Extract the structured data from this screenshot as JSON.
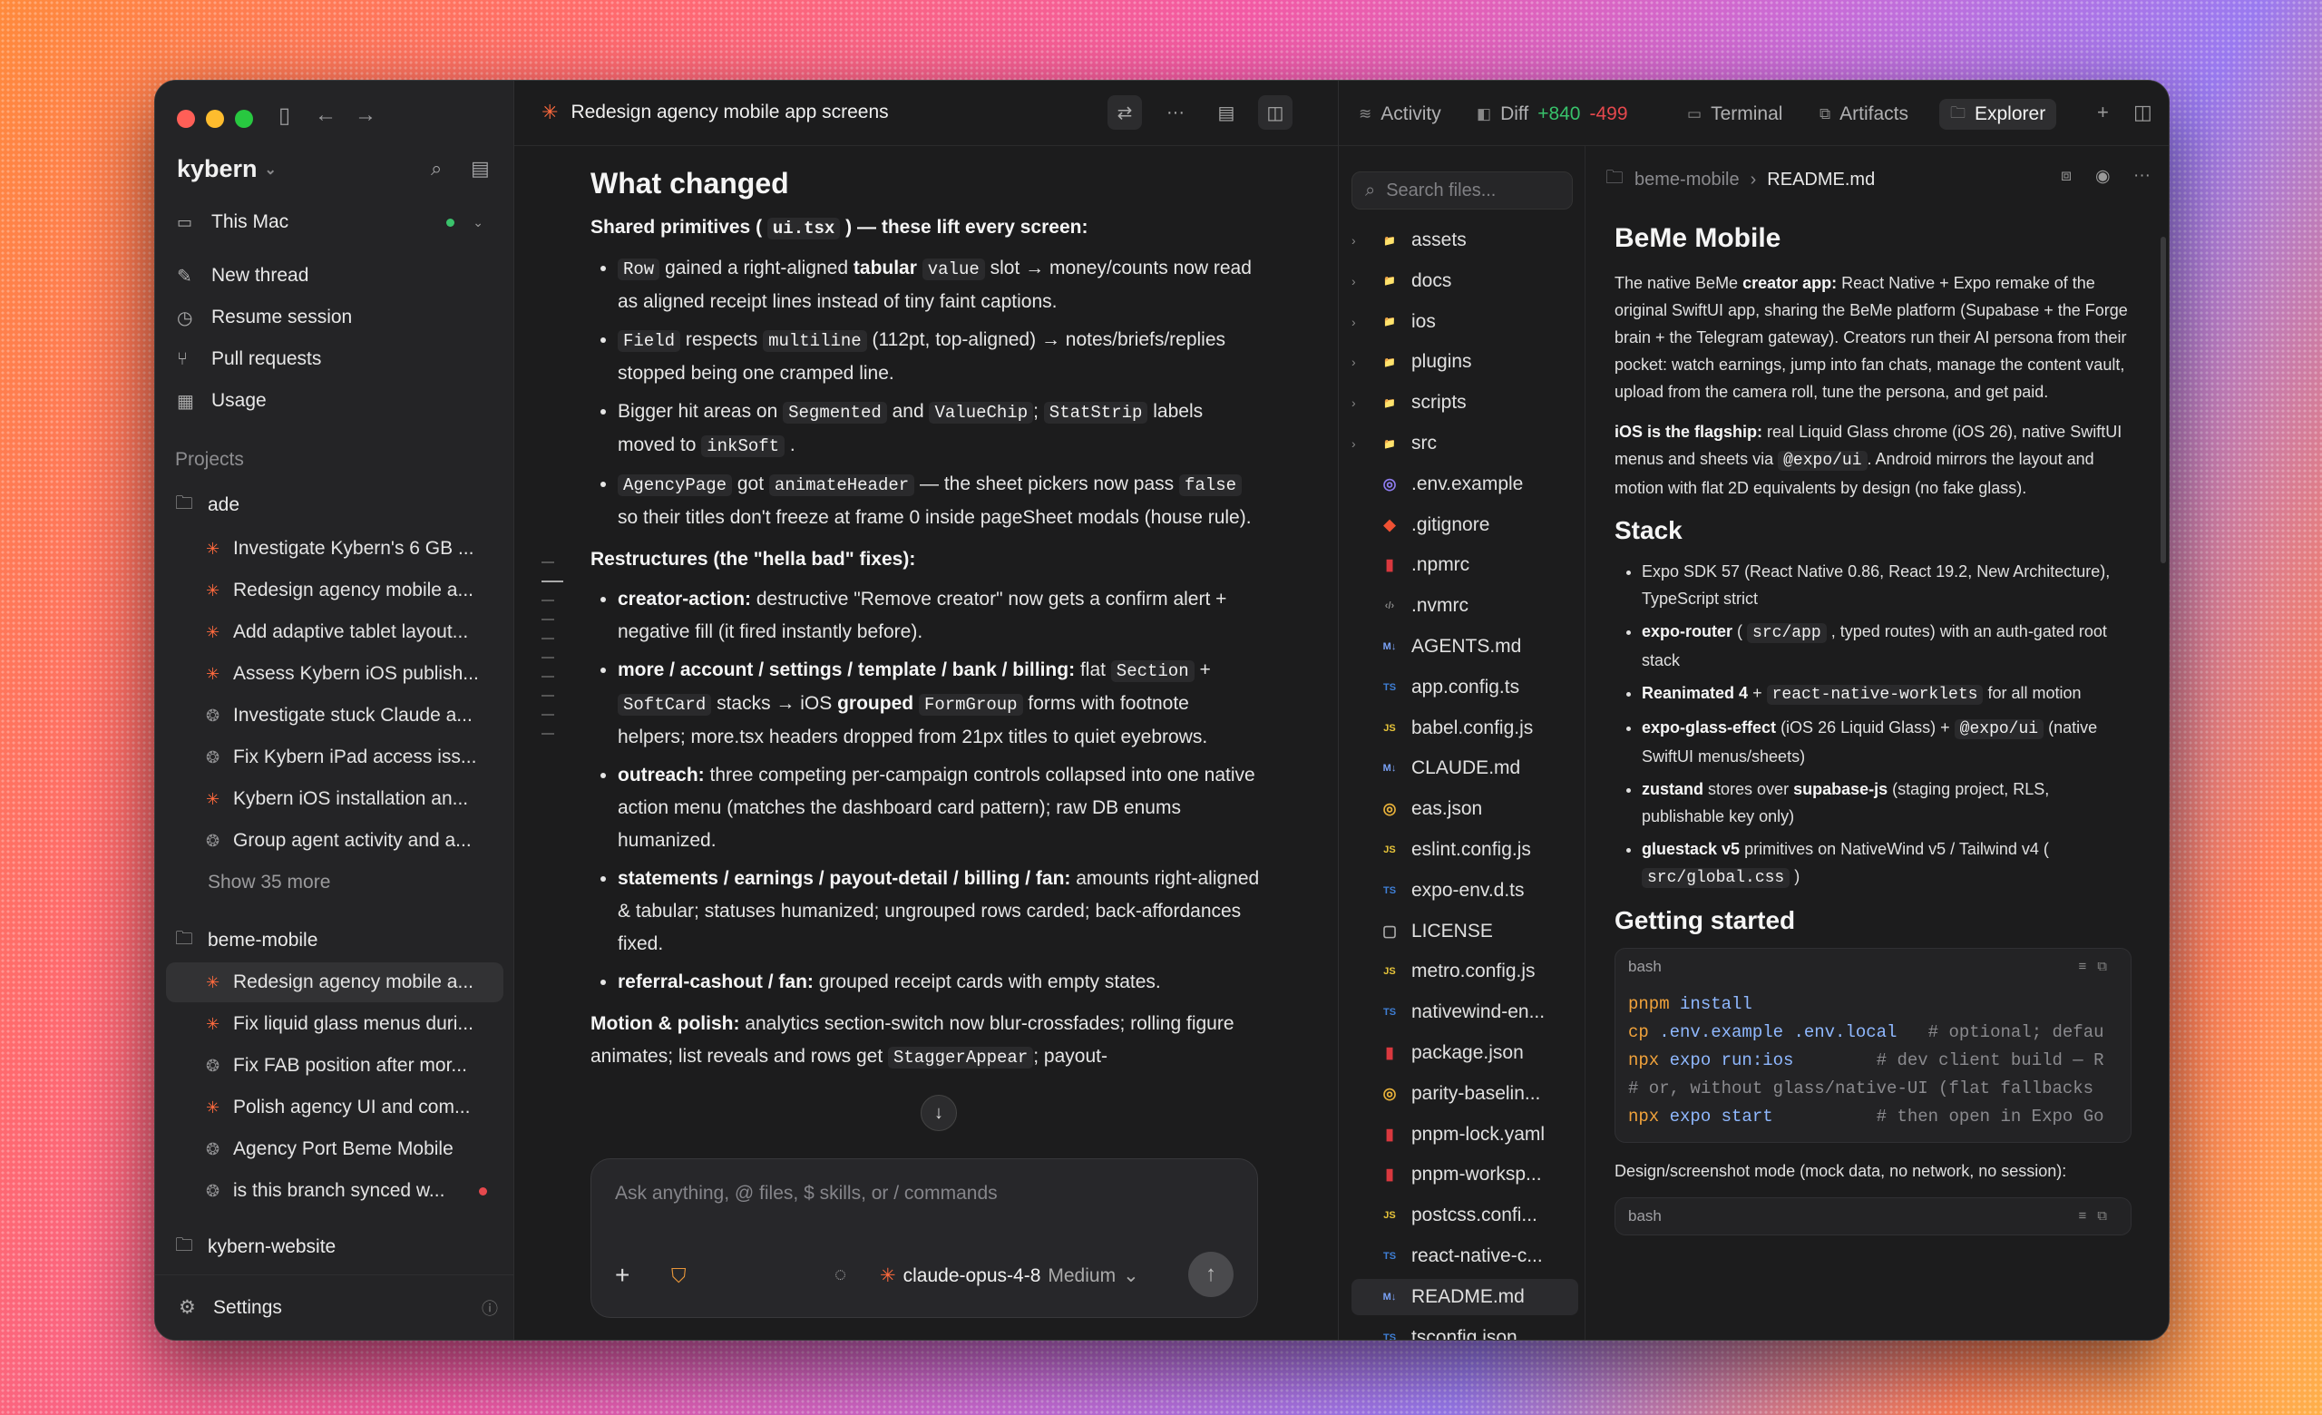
{
  "window": {
    "workspace": "kybern",
    "location": "This Mac"
  },
  "sidebar": {
    "nav": [
      {
        "icon": "compose-icon",
        "label": "New thread"
      },
      {
        "icon": "clock-icon",
        "label": "Resume session"
      },
      {
        "icon": "pull-request-icon",
        "label": "Pull requests"
      },
      {
        "icon": "chart-icon",
        "label": "Usage"
      }
    ],
    "projects_label": "Projects",
    "projects": [
      {
        "name": "ade",
        "threads": [
          "Investigate Kybern's 6 GB ...",
          "Redesign agency mobile a...",
          "Add adaptive tablet layout...",
          "Assess Kybern iOS publish...",
          "Investigate stuck Claude a...",
          "Fix Kybern iPad access iss...",
          "Kybern iOS installation an...",
          "Group agent activity and a..."
        ],
        "more": "Show 35 more"
      },
      {
        "name": "beme-mobile",
        "threads": [
          "Redesign agency mobile a...",
          "Fix liquid glass menus duri...",
          "Fix FAB position after mor...",
          "Polish agency UI and com...",
          "Agency Port Beme Mobile",
          "is this branch synced w..."
        ]
      },
      {
        "name": "kybern-website"
      }
    ],
    "settings": "Settings"
  },
  "main": {
    "title": "Redesign agency mobile app screens",
    "heading": "What changed",
    "shared": {
      "pre": "Shared primitives (",
      "code": "ui.tsx",
      "post": ") — these lift every screen:"
    },
    "b1": {
      "c1": "Row",
      "t1": "gained a right-aligned",
      "s1": "tabular",
      "c2": "value",
      "t2": "slot → money/counts now read as aligned receipt lines instead of tiny faint captions."
    },
    "b2": {
      "c1": "Field",
      "t1": "respects",
      "c2": "multiline",
      "t2": "(112pt, top-aligned) → notes/briefs/replies stopped being one cramped line."
    },
    "b3": {
      "t0": "Bigger hit areas on",
      "c1": "Segmented",
      "t1": "and",
      "c2": "ValueChip",
      "t2": ";",
      "c3": "StatStrip",
      "t3": "labels moved to",
      "c4": "inkSoft",
      "t4": "."
    },
    "b4": {
      "c1": "AgencyPage",
      "t1": "got",
      "c2": "animateHeader",
      "t2": "— the sheet pickers now pass",
      "c3": "false",
      "t3": "so their titles don't freeze at frame 0 inside pageSheet modals (house rule)."
    },
    "restruct": "Restructures (the \"hella bad\" fixes):",
    "r1": {
      "b": "creator-action:",
      "t": "destructive \"Remove creator\" now gets a confirm alert + negative fill (it fired instantly before)."
    },
    "r2": {
      "b": "more / account / settings / template / bank / billing:",
      "t0": "flat",
      "c1": "Section",
      "t1": "+",
      "c2": "SoftCard",
      "t2": "stacks → iOS",
      "b2": "grouped",
      "c3": "FormGroup",
      "t3": "forms with footnote helpers; more.tsx headers dropped from 21px titles to quiet eyebrows."
    },
    "r3": {
      "b": "outreach:",
      "t": "three competing per-campaign controls collapsed into one native action menu (matches the dashboard card pattern); raw DB enums humanized."
    },
    "r4": {
      "b": "statements / earnings / payout-detail / billing / fan:",
      "t": "amounts right-aligned & tabular; statuses humanized; ungrouped rows carded; back-affordances fixed."
    },
    "r5": {
      "b": "referral-cashout / fan:",
      "t": "grouped receipt cards with empty states."
    },
    "motion": {
      "b": "Motion & polish:",
      "t": "analytics section-switch now blur-crossfades; rolling figure animates; list reveals and rows get",
      "c": "StaggerAppear",
      "t2": "; payout-"
    },
    "composer": {
      "placeholder": "Ask anything, @ files, $ skills, or / commands",
      "model": "claude-opus-4-8",
      "level": "Medium"
    }
  },
  "right": {
    "tabs": [
      {
        "icon": "activity-icon",
        "label": "Activity"
      },
      {
        "icon": "diff-icon",
        "label": "Diff"
      },
      {
        "icon": "terminal-icon",
        "label": "Terminal"
      },
      {
        "icon": "artifacts-icon",
        "label": "Artifacts"
      },
      {
        "icon": "explorer-icon",
        "label": "Explorer"
      }
    ],
    "diff_add": "+840",
    "diff_del": "-499",
    "search_placeholder": "Search files...",
    "files": [
      {
        "n": "assets",
        "k": "dir"
      },
      {
        "n": "docs",
        "k": "dir"
      },
      {
        "n": "ios",
        "k": "dir"
      },
      {
        "n": "plugins",
        "k": "dir"
      },
      {
        "n": "scripts",
        "k": "dir"
      },
      {
        "n": "src",
        "k": "dir"
      },
      {
        "n": ".env.example",
        "k": "env"
      },
      {
        "n": ".gitignore",
        "k": "git"
      },
      {
        "n": ".npmrc",
        "k": "npm"
      },
      {
        "n": ".nvmrc",
        "k": "code"
      },
      {
        "n": "AGENTS.md",
        "k": "md"
      },
      {
        "n": "app.config.ts",
        "k": "ts"
      },
      {
        "n": "babel.config.js",
        "k": "js"
      },
      {
        "n": "CLAUDE.md",
        "k": "md"
      },
      {
        "n": "eas.json",
        "k": "json"
      },
      {
        "n": "eslint.config.js",
        "k": "js"
      },
      {
        "n": "expo-env.d.ts",
        "k": "ts"
      },
      {
        "n": "LICENSE",
        "k": "file"
      },
      {
        "n": "metro.config.js",
        "k": "js"
      },
      {
        "n": "nativewind-en...",
        "k": "ts"
      },
      {
        "n": "package.json",
        "k": "npm"
      },
      {
        "n": "parity-baselin...",
        "k": "json"
      },
      {
        "n": "pnpm-lock.yaml",
        "k": "npm"
      },
      {
        "n": "pnpm-worksp...",
        "k": "npm"
      },
      {
        "n": "postcss.confi...",
        "k": "js"
      },
      {
        "n": "react-native-c...",
        "k": "ts"
      },
      {
        "n": "README.md",
        "k": "md"
      },
      {
        "n": "tsconfig.json",
        "k": "ts"
      }
    ],
    "crumb": {
      "dir": "beme-mobile",
      "file": "README.md"
    },
    "md": {
      "h1": "BeMe Mobile",
      "p1": {
        "pre": "The native BeMe",
        "b": "creator app:",
        "t": "React Native + Expo remake of the original SwiftUI app, sharing the BeMe platform (Supabase + the Forge brain + the Telegram gateway). Creators run their AI persona from their pocket: watch earnings, jump into fan chats, manage the content vault, upload from the camera roll, tune the persona, and get paid."
      },
      "p2": {
        "b": "iOS is the flagship:",
        "t": "real Liquid Glass chrome (iOS 26), native SwiftUI menus and sheets via",
        "c": "@expo/ui",
        "t2": ". Android mirrors the layout and motion with flat 2D equivalents by design (no fake glass)."
      },
      "stack_h": "Stack",
      "s1": "Expo SDK 57 (React Native 0.86, React 19.2, New Architecture), TypeScript strict",
      "s2": {
        "b": "expo-router",
        "t0": "(",
        "c": "src/app",
        "t": ", typed routes) with an auth-gated root stack"
      },
      "s3": {
        "b": "Reanimated 4",
        "t0": "+",
        "c": "react-native-worklets",
        "t": "for all motion"
      },
      "s4": {
        "b": "expo-glass-effect",
        "t0": "(iOS 26 Liquid Glass) +",
        "c": "@expo/ui",
        "t": "(native SwiftUI menus/sheets)"
      },
      "s5": {
        "b": "zustand",
        "t0": "stores over",
        "b2": "supabase-js",
        "t": "(staging project, RLS, publishable key only)"
      },
      "s6": {
        "b": "gluestack v5",
        "t0": "primitives on NativeWind v5 / Tailwind v4 (",
        "c": "src/global.css",
        "t": ")"
      },
      "gs_h": "Getting started",
      "code_lang": "bash",
      "lines": [
        {
          "a": "pnpm",
          "b": " install",
          "c": ""
        },
        {
          "a": "cp",
          "b": " .env.example .env.local",
          "c": "   # optional; defau"
        },
        {
          "a": "npx",
          "b": " expo run:ios",
          "c": "        # dev client build — R"
        },
        {
          "a": "",
          "b": "",
          "c": "# or, without glass/native-UI (flat fallbacks"
        },
        {
          "a": "npx",
          "b": " expo start",
          "c": "          # then open in Expo Go"
        }
      ],
      "design": "Design/screenshot mode (mock data, no network, no session):",
      "code_lang2": "bash"
    }
  },
  "colors": {
    "accent": "#ff6a3d",
    "green": "#38c26b",
    "red": "#e5484d"
  }
}
